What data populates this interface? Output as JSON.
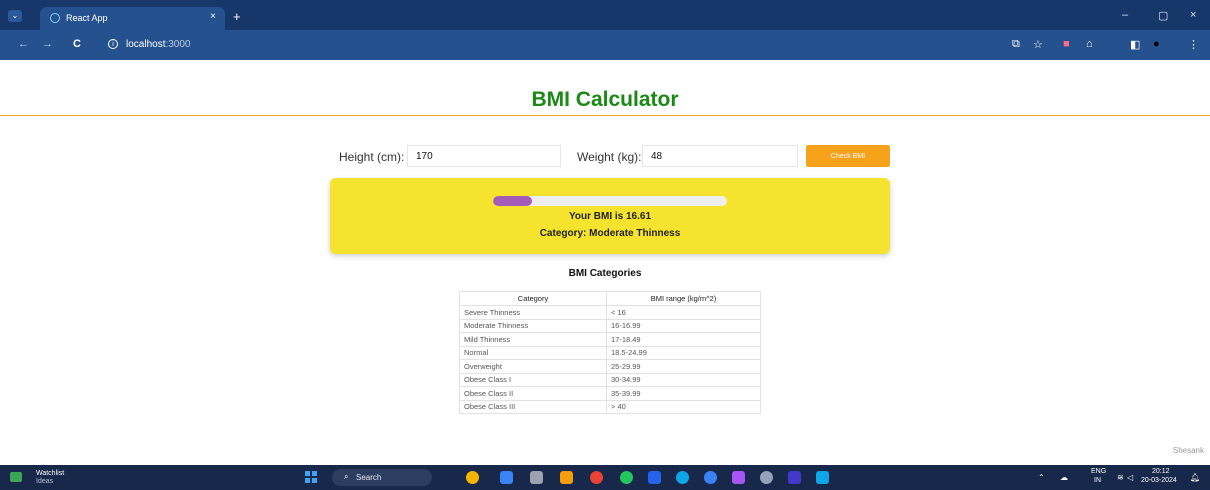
{
  "browser": {
    "tab_title": "React App",
    "tab_close": "×",
    "new_tab": "+",
    "url_host": "localhost",
    "url_port": ":3000",
    "nav_back": "←",
    "nav_forward": "→",
    "nav_reload": "C",
    "minimize": "–",
    "restore": "▢",
    "close": "×"
  },
  "app": {
    "title": "BMI Calculator",
    "height_label": "Height (cm):",
    "height_value": "170",
    "weight_label": "Weight (kg):",
    "weight_value": "48",
    "check_button": "Check BMI",
    "bmi_text": "Your BMI is 16.61",
    "category_text": "Category: Moderate Thinness",
    "progress_fraction": 0.166,
    "categories_heading": "BMI Categories",
    "table": {
      "headers": [
        "Category",
        "BMI range (kg/m^2)"
      ],
      "rows": [
        [
          "Severe Thinness",
          "< 16"
        ],
        [
          "Moderate Thinness",
          "16-16.99"
        ],
        [
          "Mild Thinness",
          "17-18.49"
        ],
        [
          "Normal",
          "18.5-24.99"
        ],
        [
          "Overweight",
          "25-29.99"
        ],
        [
          "Obese Class I",
          "30-34.99"
        ],
        [
          "Obese Class II",
          "35-39.99"
        ],
        [
          "Obese Class III",
          "> 40"
        ]
      ]
    },
    "signature": "Shesank"
  },
  "taskbar": {
    "watchlist_title": "Watchlist",
    "watchlist_sub": "Ideas",
    "search_label": "Search",
    "lang_top": "ENG",
    "lang_bottom": "IN",
    "time": "20:12",
    "date": "20-03-2024"
  },
  "colors": {
    "title_green": "#1a8a14",
    "button_orange": "#f7a21b",
    "card_yellow": "#f5e32e",
    "progress_purple": "#a55cb8"
  }
}
